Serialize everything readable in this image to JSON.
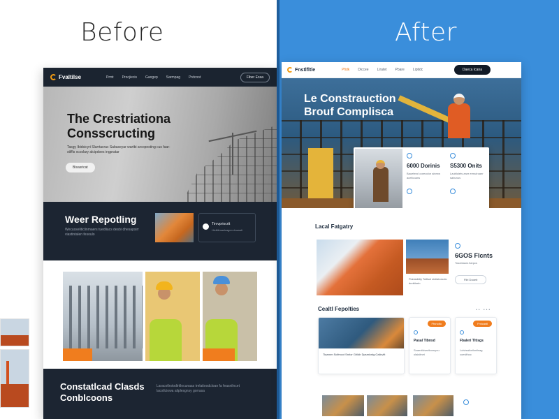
{
  "labels": {
    "before": "Before",
    "after": "After"
  },
  "before": {
    "nav": {
      "logo": "Fvaltilse",
      "links": [
        "Prmt",
        "Procjiecis",
        "Gaogep",
        "Sarmpag",
        "Prdcoot"
      ],
      "cta": "Fiber Ecaa"
    },
    "hero": {
      "title_line1": "The Crestriationa",
      "title_line2": "Consscructing",
      "subtitle": "Tasgy Ibidsicyri Slarrtacrac Sabaseyar wartbi arcopesting cus faar-stiffis xcoslary alcipdoes ingpratar",
      "button": "Bisasricat"
    },
    "section2": {
      "title": "Weer Repotling",
      "subtitle": "Wecusseliticlinmaers tuedliacs desbi dhesapsirr viastintalen fesoulo",
      "card_title": "Tinrvpriocrtt",
      "card_sub": "Hicliitlmaslcagen rbwaalt"
    },
    "footer": {
      "title_line1": "Constatlcad Clasds",
      "title_line2": "Conblcoons",
      "subtitle": "Laracotlrstodiritlocunaas trelaitoodcloan fa feasnilncet lacotlciowa aliplesgnsy gorrasa"
    }
  },
  "after": {
    "nav": {
      "logo": "Fnstlfltle",
      "links": [
        "Pfidk",
        "Diccee",
        "Liratet",
        "Pbare",
        "Liptidc"
      ],
      "active_index": 0,
      "cta": "Daeca Icana"
    },
    "hero": {
      "title_line1": "Le Constrauction",
      "title_line2": "Brouf Complisca",
      "stat1_value": "6000 Dorinis",
      "stat1_text": "Baueterol ooreoctor ainrnw acetlcoans",
      "stat2_value": "S5300 Onits",
      "stat2_text": "Laubloiets arwr ermuiroanr sabunus"
    },
    "section2": {
      "title": "Lacal Fatgatry",
      "caption": "Fluioiabitiy Toltlsol siniiatoroolo dnrbiiorin",
      "stat": "6GOS Flcnts",
      "stat_text": "Tosobiaors llarpcs",
      "button": "Fliri Dooeb"
    },
    "section3": {
      "title": "Cealtl Fepolties",
      "dots": "•• •••",
      "card1_text": "Tiaarnm Scifmcot  Snrlor Grlldir Dpsmicstg Galicvilt",
      "card2_tag": "Ffnnolto",
      "card2_title": "Pasal Tibnsd",
      "card2_text": "Soaeviidsarilcomyou olaisitnet",
      "card3_tag": "Fmicastl",
      "card3_title": "Fbaleri Tltisgs",
      "card3_text": "Lolvtsailorilonlisag coeslthoc"
    }
  },
  "colors": {
    "right_bg": "#3a8edb",
    "dark_navy": "#1c2532",
    "accent_orange": "#f07d1e"
  }
}
